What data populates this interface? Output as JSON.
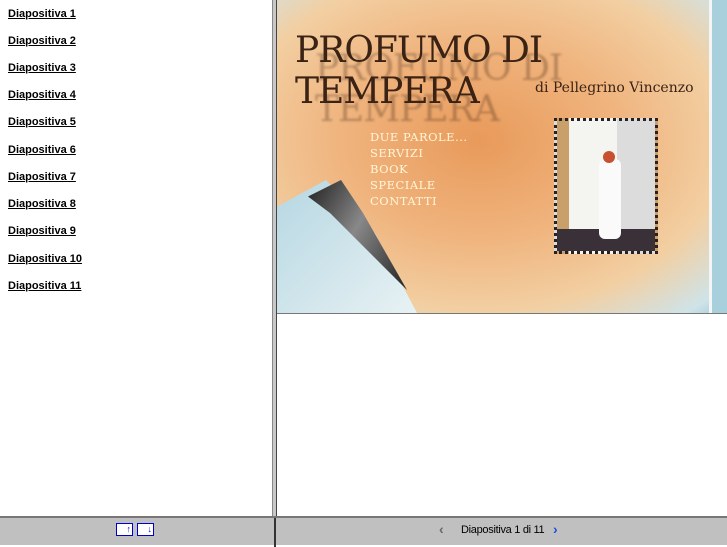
{
  "slides": [
    "Diapositiva 1",
    "Diapositiva 2",
    "Diapositiva 3",
    "Diapositiva 4",
    "Diapositiva 5",
    "Diapositiva 6",
    "Diapositiva 7",
    "Diapositiva 8",
    "Diapositiva 9",
    "Diapositiva 10",
    "Diapositiva 11"
  ],
  "slide": {
    "title": "PROFUMO DI TEMPERA",
    "subtitle": "di Pellegrino Vincenzo",
    "menu": [
      "DUE PAROLE...",
      "SERVIZI",
      "BOOK",
      "SPECIALE",
      "CONTATTI"
    ]
  },
  "footer": {
    "status": "Diapositiva 1 di 11",
    "prev": "‹",
    "next": "›",
    "expand": "↑",
    "collapse": "↓"
  }
}
